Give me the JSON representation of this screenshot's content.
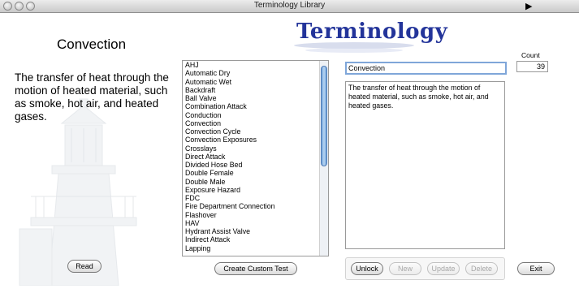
{
  "window": {
    "title": "Terminology Library"
  },
  "logo": {
    "text": "Terminology"
  },
  "term": {
    "heading": "Convection",
    "definition": "The transfer of heat through the motion of heated material, such as smoke, hot air, and heated gases."
  },
  "list": {
    "items": [
      "AHJ",
      "Automatic Dry",
      "Automatic Wet",
      "Backdraft",
      "Ball Valve",
      "Combination Attack",
      "Conduction",
      "Convection",
      "Convection Cycle",
      "Convection Exposures",
      "Crosslays",
      "Direct Attack",
      "Divided Hose Bed",
      "Double Female",
      "Double Male",
      "Exposure Hazard",
      "FDC",
      "Fire Department Connection",
      "Flashover",
      "HAV",
      "Hydrant Assist Valve",
      "Indirect Attack",
      "Lapping"
    ]
  },
  "editor": {
    "term_value": "Convection",
    "definition_value": "The transfer of heat through the motion of heated material, such as smoke, hot air, and heated gases.",
    "count_label": "Count",
    "count_value": "39"
  },
  "buttons": {
    "read": "Read",
    "create_custom_test": "Create Custom Test",
    "unlock": "Unlock",
    "new": "New",
    "update": "Update",
    "delete": "Delete",
    "exit": "Exit"
  }
}
